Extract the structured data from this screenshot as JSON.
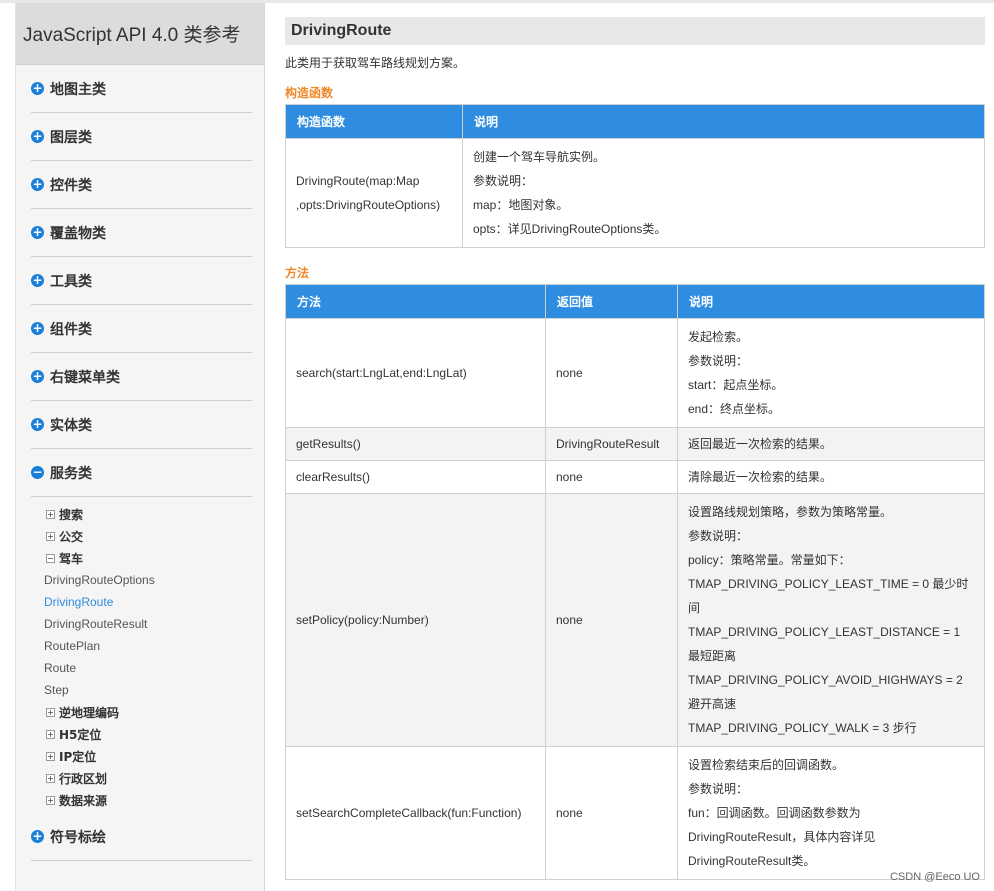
{
  "sidebar": {
    "title": "JavaScript API 4.0 类参考",
    "categories": [
      "地图主类",
      "图层类",
      "控件类",
      "覆盖物类",
      "工具类",
      "组件类",
      "右键菜单类",
      "实体类"
    ],
    "service": {
      "label": "服务类",
      "items": [
        {
          "label": "搜索",
          "toggle": "+"
        },
        {
          "label": "公交",
          "toggle": "+"
        },
        {
          "label": "驾车",
          "toggle": "−"
        }
      ],
      "leaves": [
        "DrivingRouteOptions",
        "DrivingRoute",
        "DrivingRouteResult",
        "RoutePlan",
        "Route",
        "Step"
      ],
      "items_after": [
        {
          "label": "逆地理编码",
          "toggle": "+"
        },
        {
          "label": "H5定位",
          "toggle": "+"
        },
        {
          "label": "IP定位",
          "toggle": "+"
        },
        {
          "label": "行政区划",
          "toggle": "+"
        },
        {
          "label": "数据来源",
          "toggle": "+"
        }
      ]
    },
    "last_category": "符号标绘",
    "plus_symbol": "+",
    "minus_symbol": "−"
  },
  "main": {
    "title": "DrivingRoute",
    "description": "此类用于获取驾车路线规划方案。",
    "constructor_section": "构造函数",
    "constructor_table": {
      "headers": [
        "构造函数",
        "说明"
      ],
      "rows": [
        {
          "signature": "DrivingRoute(map:Map ,opts:DrivingRouteOptions)",
          "desc": [
            "创建一个驾车导航实例。",
            "参数说明：",
            "map：地图对象。",
            "opts：详见DrivingRouteOptions类。"
          ]
        }
      ]
    },
    "methods_section": "方法",
    "methods_table": {
      "headers": [
        "方法",
        "返回值",
        "说明"
      ],
      "rows": [
        {
          "method": "search(start:LngLat,end:LngLat)",
          "returns": "none",
          "desc": [
            "发起检索。",
            "参数说明：",
            "start：起点坐标。",
            "end：终点坐标。"
          ]
        },
        {
          "method": "getResults()",
          "returns": "DrivingRouteResult",
          "desc": [
            "返回最近一次检索的结果。"
          ]
        },
        {
          "method": "clearResults()",
          "returns": "none",
          "desc": [
            "清除最近一次检索的结果。"
          ]
        },
        {
          "method": "setPolicy(policy:Number)",
          "returns": "none",
          "desc": [
            "设置路线规划策略，参数为策略常量。",
            "参数说明：",
            "policy：策略常量。常量如下：",
            "TMAP_DRIVING_POLICY_LEAST_TIME = 0 最少时间",
            "TMAP_DRIVING_POLICY_LEAST_DISTANCE = 1 最短距离",
            "TMAP_DRIVING_POLICY_AVOID_HIGHWAYS = 2 避开高速",
            "TMAP_DRIVING_POLICY_WALK = 3 步行"
          ]
        },
        {
          "method": "setSearchCompleteCallback(fun:Function)",
          "returns": "none",
          "desc": [
            "设置检索结束后的回调函数。",
            "参数说明：",
            "fun：回调函数。回调函数参数为DrivingRouteResult，具体内容详见DrivingRouteResult类。"
          ]
        }
      ]
    }
  },
  "watermark": "CSDN @Eeco UO",
  "colors": {
    "accent": "#2e8de0",
    "section": "#f0882b",
    "icon": "#1a7fd9"
  }
}
